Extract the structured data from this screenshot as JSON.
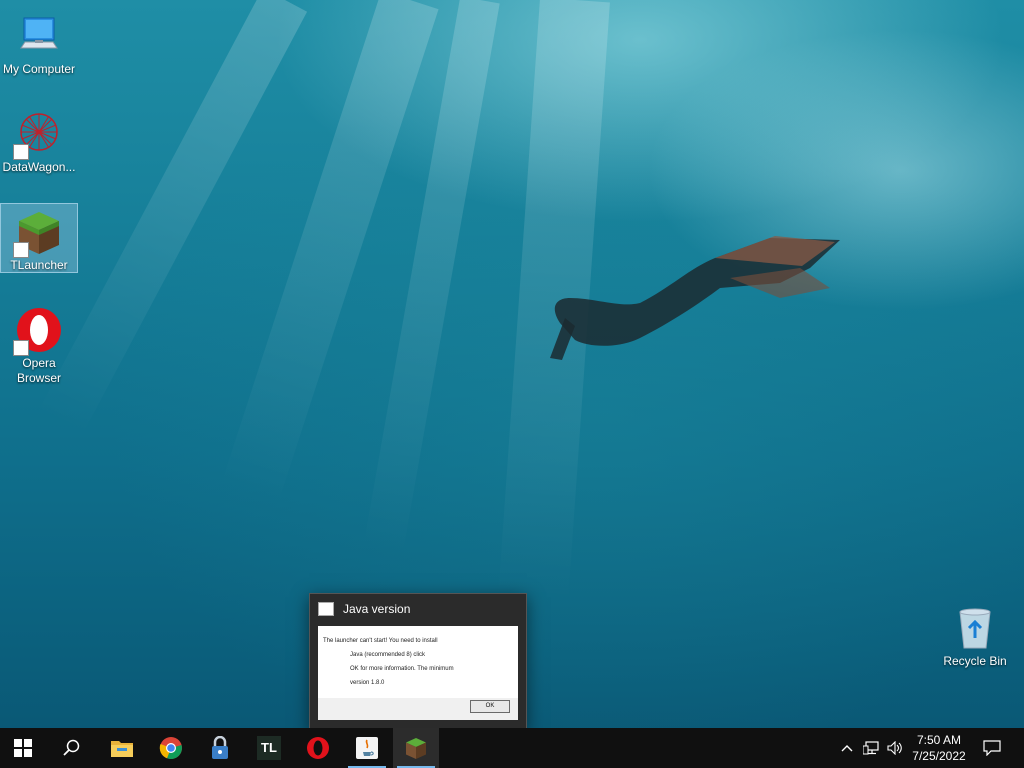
{
  "desktop": {
    "icons": [
      {
        "label": "My Computer",
        "icon": "computer-icon"
      },
      {
        "label": "DataWagon...",
        "icon": "datawagon-icon"
      },
      {
        "label": "TLauncher",
        "icon": "minecraft-grass-block-icon"
      },
      {
        "label": "Opera Browser",
        "icon": "opera-icon"
      },
      {
        "label": "Recycle Bin",
        "icon": "recycle-bin-icon"
      }
    ]
  },
  "dialog": {
    "title": "Java version",
    "lines": [
      "The launcher can't start! You need to install",
      "Java (recommended 8) click",
      "OK for more information. The minimum",
      "version 1.8.0"
    ],
    "ok_label": "OK"
  },
  "taskbar": {
    "apps": [
      {
        "name": "start",
        "icon": "windows-logo-icon"
      },
      {
        "name": "search",
        "icon": "search-icon"
      },
      {
        "name": "file-explorer",
        "icon": "folder-icon"
      },
      {
        "name": "chrome",
        "icon": "chrome-icon"
      },
      {
        "name": "lock-app",
        "icon": "padlock-icon"
      },
      {
        "name": "tlauncher",
        "icon": "tl-icon",
        "text": "TL"
      },
      {
        "name": "opera",
        "icon": "opera-icon"
      },
      {
        "name": "java",
        "icon": "java-icon"
      },
      {
        "name": "minecraft",
        "icon": "minecraft-grass-block-icon"
      }
    ],
    "tray": {
      "time": "7:50 AM",
      "date": "7/25/2022"
    }
  },
  "colors": {
    "taskbar": "#101010",
    "running_indicator": "#76b9ed",
    "opera_red": "#e1121b"
  }
}
